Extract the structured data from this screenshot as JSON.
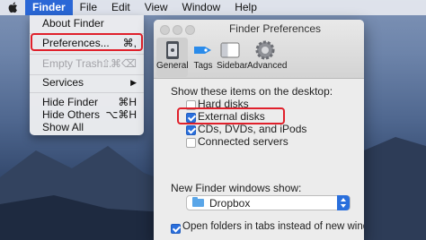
{
  "menubar": {
    "apple": "apple-icon",
    "items": [
      {
        "label": "Finder",
        "active": true
      },
      {
        "label": "File"
      },
      {
        "label": "Edit"
      },
      {
        "label": "View"
      },
      {
        "label": "Window"
      },
      {
        "label": "Help"
      }
    ]
  },
  "finder_menu": {
    "about": "About Finder",
    "preferences": {
      "label": "Preferences...",
      "shortcut": "⌘,"
    },
    "empty_trash": {
      "label": "Empty Trash...",
      "shortcut": "⇧⌘⌫"
    },
    "services": {
      "label": "Services",
      "submenu_arrow": "▶"
    },
    "hide_finder": {
      "label": "Hide Finder",
      "shortcut": "⌘H"
    },
    "hide_others": {
      "label": "Hide Others",
      "shortcut": "⌥⌘H"
    },
    "show_all": "Show All"
  },
  "prefs_window": {
    "title": "Finder Preferences",
    "tabs": [
      {
        "label": "General",
        "icon": "general-icon",
        "selected": true
      },
      {
        "label": "Tags",
        "icon": "tag-icon"
      },
      {
        "label": "Sidebar",
        "icon": "sidebar-icon"
      },
      {
        "label": "Advanced",
        "icon": "gear-icon"
      }
    ],
    "desktop_heading": "Show these items on the desktop:",
    "desktop_items": [
      {
        "label": "Hard disks",
        "checked": false
      },
      {
        "label": "External disks",
        "checked": true
      },
      {
        "label": "CDs, DVDs, and iPods",
        "checked": true
      },
      {
        "label": "Connected servers",
        "checked": false
      }
    ],
    "new_window_heading": "New Finder windows show:",
    "new_window_value": "Dropbox",
    "open_folders_tabs": {
      "label": "Open folders in tabs instead of new windows",
      "checked": true
    }
  },
  "colors": {
    "accent": "#2a6fdc",
    "highlight_box": "#e0202b",
    "menu_active": "#2a67d6"
  }
}
